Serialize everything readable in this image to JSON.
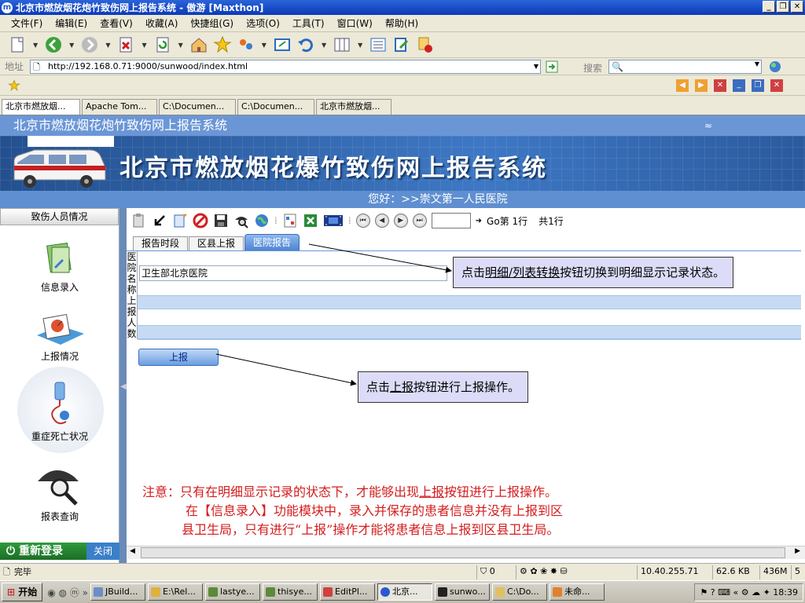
{
  "window": {
    "title": "北京市燃放烟花炮竹致伤网上报告系统 - 傲游 [Maxthon]"
  },
  "menu": [
    "文件(F)",
    "编辑(E)",
    "查看(V)",
    "收藏(A)",
    "快捷组(G)",
    "选项(O)",
    "工具(T)",
    "窗口(W)",
    "帮助(H)"
  ],
  "address": {
    "label": "地址",
    "url": "http://192.168.0.71:9000/sunwood/index.html",
    "search_label": "搜索"
  },
  "browser_tabs": [
    "北京市燃放烟...",
    "Apache Tom...",
    "C:\\Documen...",
    "C:\\Documen...",
    "北京市燃放烟..."
  ],
  "system": {
    "header_title": "北京市燃放烟花炮竹致伤网上报告系统",
    "collapse": "≈",
    "banner_title": "北京市燃放烟花爆竹致伤网上报告系统",
    "greeting": "您好：>>崇文第一人民医院"
  },
  "sidebar": {
    "heading": "致伤人员情况",
    "items": [
      {
        "label": "信息录入"
      },
      {
        "label": "上报情况"
      },
      {
        "label": "重症死亡状况"
      },
      {
        "label": "报表查询"
      }
    ],
    "relogin": "重新登录",
    "close": "关闭"
  },
  "content_toolbar": {
    "go_label": "Go第 1行",
    "total_label": "共1行",
    "page_value": ""
  },
  "page_tabs": [
    "报告时段",
    "区县上报",
    "医院报告"
  ],
  "form": {
    "hospital_label": "医院名称",
    "hospital_value": "卫生部北京医院",
    "reporter_label": "上报人数",
    "report_button": "上报"
  },
  "callouts": {
    "detail": {
      "prefix": "点击",
      "link": "明细/列表转换",
      "suffix": "按钮切换到明细显示记录状态。"
    },
    "report": {
      "prefix": "点击",
      "link": "上报",
      "suffix": "按钮进行上报操作。"
    }
  },
  "note": {
    "line1_prefix": "注意：只有在明细显示记录的状态下，才能够出现",
    "line1_link": "上报",
    "line1_suffix": "按钮进行上报操作。",
    "line2": "在【信息录入】功能模块中，录入并保存的患者信息并没有上报到区",
    "line3": "县卫生局，只有进行“上报”操作才能将患者信息上报到区县卫生局。"
  },
  "status": {
    "done": "完毕",
    "count": "0",
    "ip": "10.40.255.71",
    "size": "62.6 KB",
    "mem": "436M",
    "num": "5"
  },
  "taskbar": {
    "start": "开始",
    "tasks": [
      "JBuild...",
      "E:\\Rel...",
      "lastye...",
      "thisye...",
      "EditPl...",
      "北京...",
      "sunwo...",
      "C:\\Do...",
      "未命..."
    ],
    "time": "18:39"
  }
}
